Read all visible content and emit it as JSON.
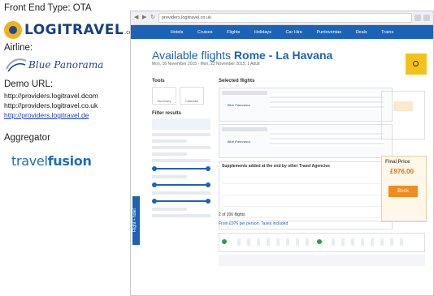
{
  "left_panel": {
    "front_end_label": "Front End Type: OTA",
    "logo": {
      "name": "LOGITRAVEL",
      "suffix": ".com",
      "brand_color": "#183f86",
      "mark_color": "#f2b21b"
    },
    "airline_label": "Airline:",
    "airline_logo": {
      "name": "Blue Panorama",
      "brand_color": "#1e3f8f",
      "accent_color": "#9aa6b4"
    },
    "demo_url_label": "Demo URL:",
    "demo_urls": [
      "http://providers.logitravel.dcom",
      "http://providers.logitravel.co.uk",
      "http://providers.logitravel.de"
    ],
    "aggregator_label": "Aggregator",
    "aggregator_logo": {
      "name_light": "travel",
      "name_bold": "fusion",
      "brand_color": "#1d6fba"
    }
  },
  "screenshot": {
    "address_bar": "providers.logitravel.co.uk",
    "nav_items": [
      "Hotels",
      "Cruises",
      "Flights",
      "Holidays",
      "Car Hire",
      "Puntoventas",
      "Deals",
      "Trains"
    ],
    "page_title_prefix": "Available flights ",
    "page_title_route": "Rome - La Havana",
    "subtitle": "Mon, 16 November 2015 - Mon, 23 November 2015, 1 Adult",
    "tools_label": "Tools",
    "tools_buttons": [
      "Summary",
      "Calendar"
    ],
    "filter_label": "Filter results",
    "selected_label": "Selected flights",
    "supplements_label": "Supplements added at the end by other Travel Agencies",
    "final_price_label": "Final Price",
    "final_price_value": "£976.00",
    "book_label": "Book",
    "results_count": "2 of 206 flights",
    "results_price_note": "From £976 per person. Taxes included",
    "feedback_label": "Flight + hotel",
    "accent_color": "#1c63b8",
    "orange_color": "#f28b1f"
  }
}
